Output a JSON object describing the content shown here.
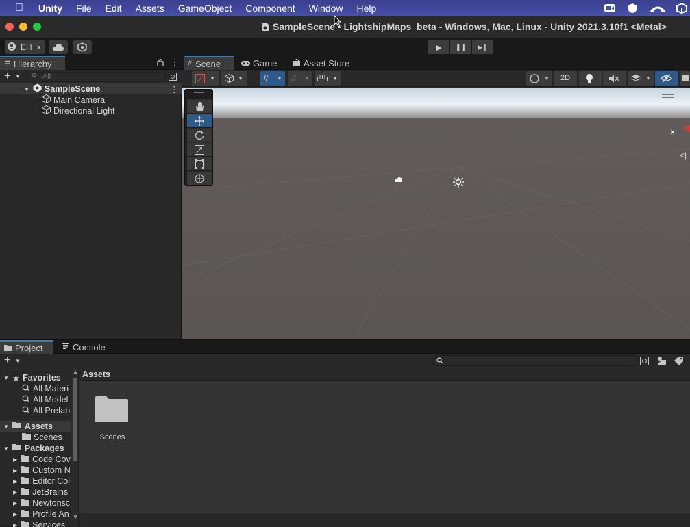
{
  "menubar": {
    "app": "Unity",
    "items": [
      "File",
      "Edit",
      "Assets",
      "GameObject",
      "Component",
      "Window",
      "Help"
    ],
    "tray_icons": [
      "zoom-icon",
      "shield-icon",
      "cloud-icon",
      "unity-icon"
    ]
  },
  "window": {
    "title": "SampleScene - LightshipMaps_beta - Windows, Mac, Linux - Unity 2021.3.10f1 <Metal>"
  },
  "toolbar": {
    "account": "EH",
    "play_label": "▶",
    "pause_label": "❚❚",
    "step_label": "▶❙"
  },
  "hierarchy": {
    "tab": "Hierarchy",
    "search_placeholder": "All",
    "scene": "SampleScene",
    "items": [
      "Main Camera",
      "Directional Light"
    ]
  },
  "scene_view": {
    "tabs": [
      "Scene",
      "Game",
      "Asset Store"
    ],
    "toggle_2d": "2D",
    "axis_label": "x"
  },
  "project": {
    "tabs": [
      "Project",
      "Console"
    ],
    "favorites_label": "Favorites",
    "favorites": [
      "All Materi",
      "All Model",
      "All Prefab"
    ],
    "assets_label": "Assets",
    "assets_children": [
      "Scenes"
    ],
    "packages_label": "Packages",
    "packages": [
      "Code Cov",
      "Custom N",
      "Editor Coi",
      "JetBrains",
      "Newtonsc",
      "Profile An",
      "Services"
    ],
    "breadcrumb": "Assets",
    "grid_items": [
      "Scenes"
    ]
  },
  "colors": {
    "menubar": "#4750a8",
    "sky": "#e7ecf0",
    "ground": "#5a5553",
    "accent": "#3a79bb"
  }
}
